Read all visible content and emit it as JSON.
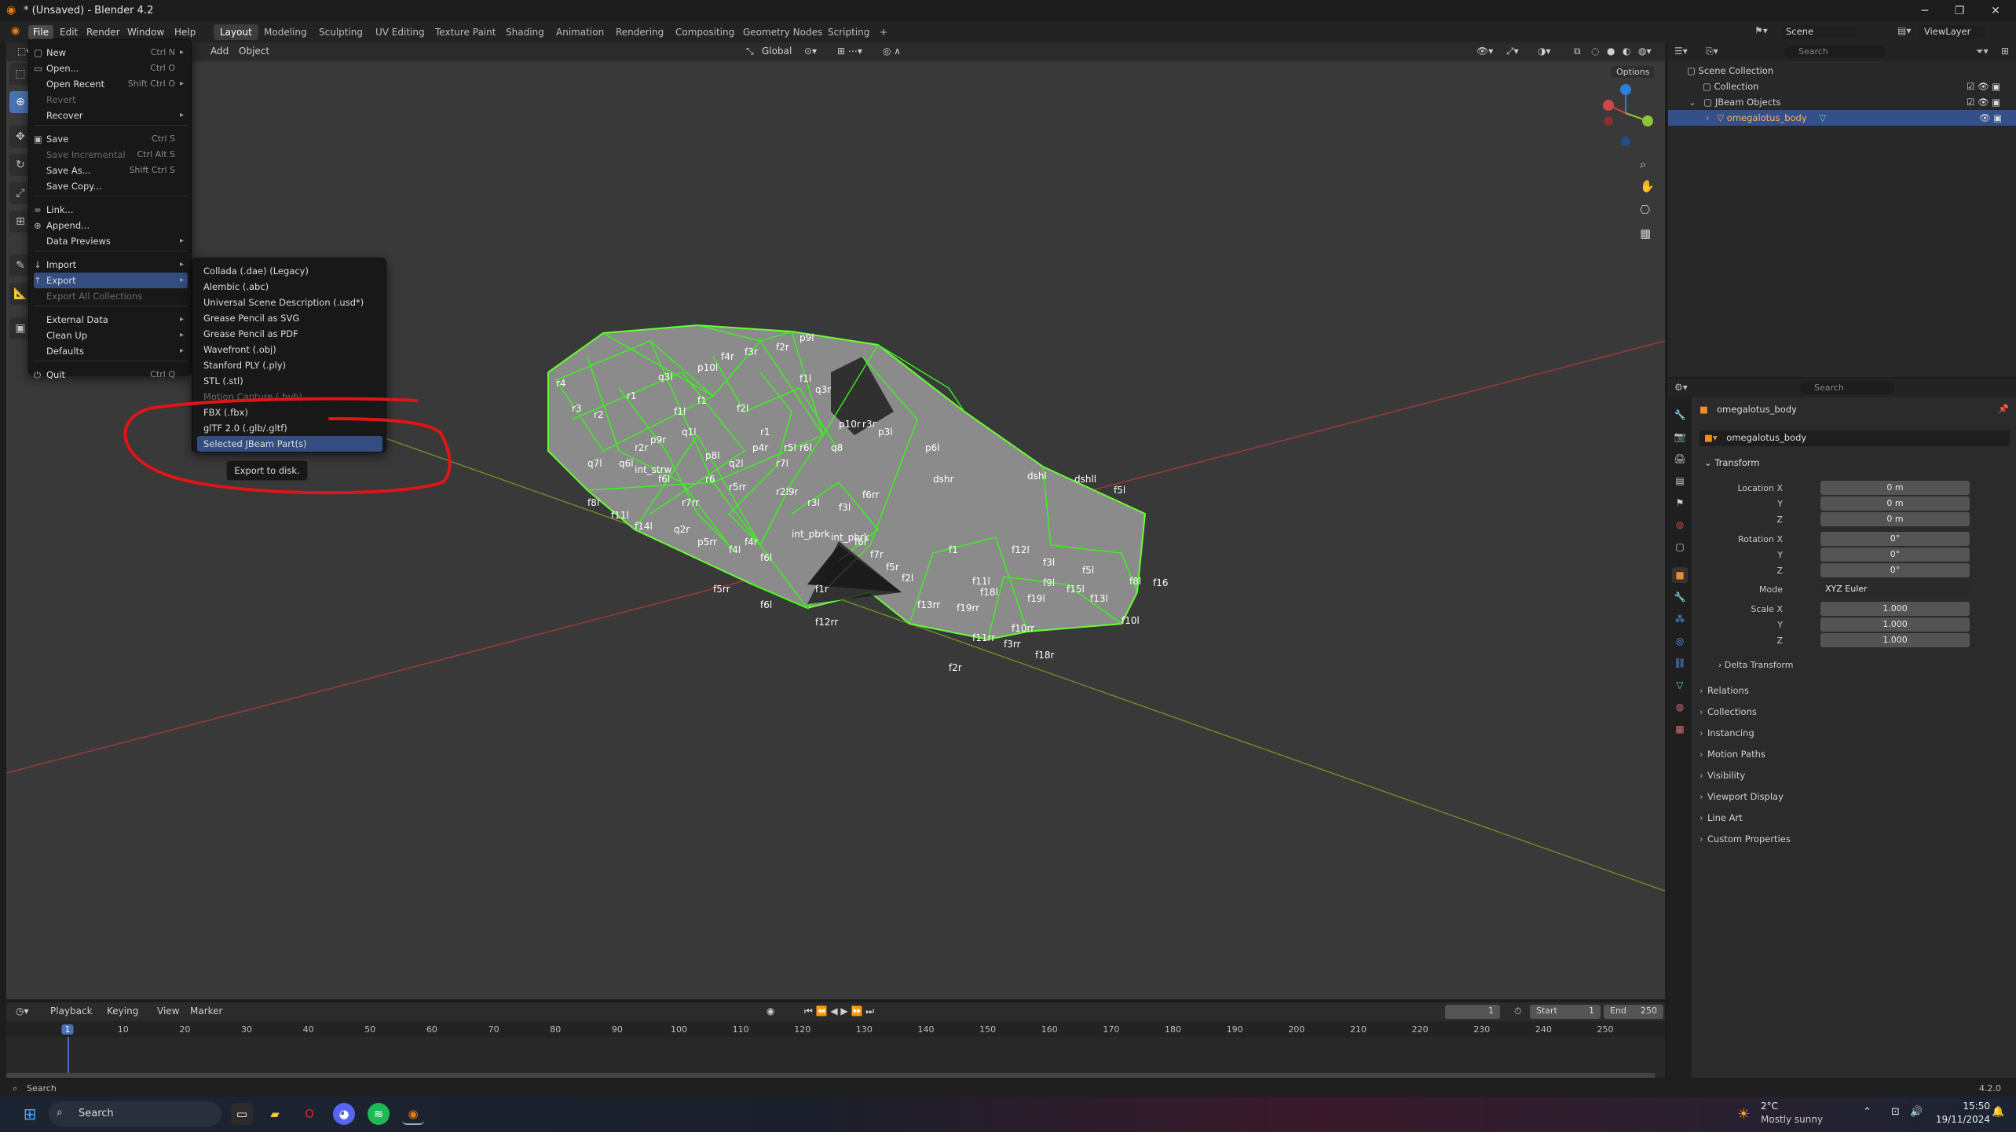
{
  "window": {
    "title": "* (Unsaved) - Blender 4.2"
  },
  "topmenu": [
    "File",
    "Edit",
    "Render",
    "Window",
    "Help"
  ],
  "workspaces": [
    "Layout",
    "Modeling",
    "Sculpting",
    "UV Editing",
    "Texture Paint",
    "Shading",
    "Animation",
    "Rendering",
    "Compositing",
    "Geometry Nodes",
    "Scripting"
  ],
  "scene": {
    "label": "Scene",
    "viewlayer": "ViewLayer"
  },
  "viewport_header": {
    "add": "Add",
    "object": "Object",
    "orientation": "Global",
    "options": "Options"
  },
  "file_menu": [
    {
      "icon": "▢",
      "label": "New",
      "shortcut": "Ctrl N",
      "submenu": true
    },
    {
      "icon": "▭",
      "label": "Open...",
      "shortcut": "Ctrl O"
    },
    {
      "label": "Open Recent",
      "shortcut": "Shift Ctrl O",
      "submenu": true
    },
    {
      "label": "Revert",
      "disabled": true
    },
    {
      "label": "Recover",
      "submenu": true
    },
    {
      "icon": "▣",
      "label": "Save",
      "shortcut": "Ctrl S"
    },
    {
      "label": "Save Incremental",
      "shortcut": "Ctrl Alt S",
      "disabled": true
    },
    {
      "label": "Save As...",
      "shortcut": "Shift Ctrl S"
    },
    {
      "label": "Save Copy..."
    },
    {
      "icon": "∞",
      "label": "Link..."
    },
    {
      "icon": "⊕",
      "label": "Append..."
    },
    {
      "label": "Data Previews",
      "submenu": true
    },
    {
      "icon": "↓",
      "label": "Import",
      "submenu": true
    },
    {
      "icon": "↑",
      "label": "Export",
      "submenu": true
    },
    {
      "label": "Export All Collections",
      "disabled": true
    },
    {
      "label": "External Data",
      "submenu": true
    },
    {
      "label": "Clean Up",
      "submenu": true
    },
    {
      "label": "Defaults",
      "submenu": true
    },
    {
      "icon": "⏻",
      "label": "Quit",
      "shortcut": "Ctrl Q"
    }
  ],
  "export_menu": [
    "Collada (.dae) (Legacy)",
    "Alembic (.abc)",
    "Universal Scene Description (.usd*)",
    "Grease Pencil as SVG",
    "Grease Pencil as PDF",
    "Wavefront (.obj)",
    "Stanford PLY (.ply)",
    "STL (.stl)",
    "Motion Capture (.bvh)",
    "FBX (.fbx)",
    "glTF 2.0 (.glb/.gltf)",
    "Selected JBeam Part(s)"
  ],
  "tooltip": "Export to disk.",
  "outliner": {
    "search_placeholder": "Search",
    "rows": [
      "Scene Collection",
      "Collection",
      "JBeam Objects",
      "omegalotus_body"
    ]
  },
  "properties": {
    "search_placeholder": "Search",
    "object_name": "omegalotus_body",
    "datablock": "omegalotus_body",
    "transform_title": "Transform",
    "location_label": "Location X",
    "location": [
      "0 m",
      "0 m",
      "0 m"
    ],
    "rotation_label": "Rotation X",
    "rotation": [
      "0°",
      "0°",
      "0°"
    ],
    "mode_label": "Mode",
    "mode": "XYZ Euler",
    "scale_label": "Scale X",
    "scale": [
      "1.000",
      "1.000",
      "1.000"
    ],
    "axis_y": "Y",
    "axis_z": "Z",
    "delta": "Delta Transform",
    "sections": [
      "Relations",
      "Collections",
      "Instancing",
      "Motion Paths",
      "Visibility",
      "Viewport Display",
      "Line Art",
      "Custom Properties"
    ]
  },
  "timeline": {
    "playback": "Playback",
    "keying": "Keying",
    "view": "View",
    "marker": "Marker",
    "current_frame": "1",
    "start_label": "Start",
    "start": "1",
    "end_label": "End",
    "end": "250",
    "ticks": [
      "1",
      "10",
      "20",
      "30",
      "40",
      "50",
      "60",
      "70",
      "80",
      "90",
      "100",
      "110",
      "120",
      "130",
      "140",
      "150",
      "160",
      "170",
      "180",
      "190",
      "200",
      "210",
      "220",
      "230",
      "240",
      "250"
    ]
  },
  "status": {
    "left": "Search",
    "version": "4.2.0"
  },
  "taskbar": {
    "search": "Search",
    "weather_temp": "2°C",
    "weather_desc": "Mostly sunny",
    "time": "15:50",
    "date": "19/11/2024"
  },
  "mesh_labels": [
    "r4",
    "r3",
    "r2",
    "r1",
    "q3l",
    "p10l",
    "f4r",
    "f3r",
    "f2r",
    "p9l",
    "f1l",
    "f1",
    "f2l",
    "f1l",
    "q3r",
    "p10r",
    "r3r",
    "r2r",
    "p9r",
    "q1l",
    "p8l",
    "q2l",
    "p4r",
    "r1",
    "r7l",
    "r5l",
    "r6l",
    "q8",
    "p3l",
    "p6l",
    "q7l",
    "q6l",
    "int_strw",
    "f6l",
    "r7rr",
    "r6",
    "r5rr",
    "r2l9r",
    "r3l",
    "f3l",
    "f6rr",
    "dshr",
    "dshl",
    "dshll",
    "f5l",
    "f8l",
    "f11l",
    "f14l",
    "q2r",
    "p5rr",
    "f4l",
    "f6l",
    "int_pbrk",
    "int_pbrk",
    "f6r",
    "f7r",
    "f5r",
    "f2l",
    "f1",
    "f12l",
    "f3l",
    "f5l",
    "f8l",
    "f16",
    "f15l",
    "f9l",
    "f13l",
    "f10l",
    "f11l",
    "f18l",
    "f19l",
    "f10rr",
    "f11rr",
    "f18r",
    "f19rr",
    "f13rr",
    "f12rr",
    "f1r",
    "f2r",
    "f3rr",
    "f4r",
    "f5rr",
    "f6l"
  ]
}
